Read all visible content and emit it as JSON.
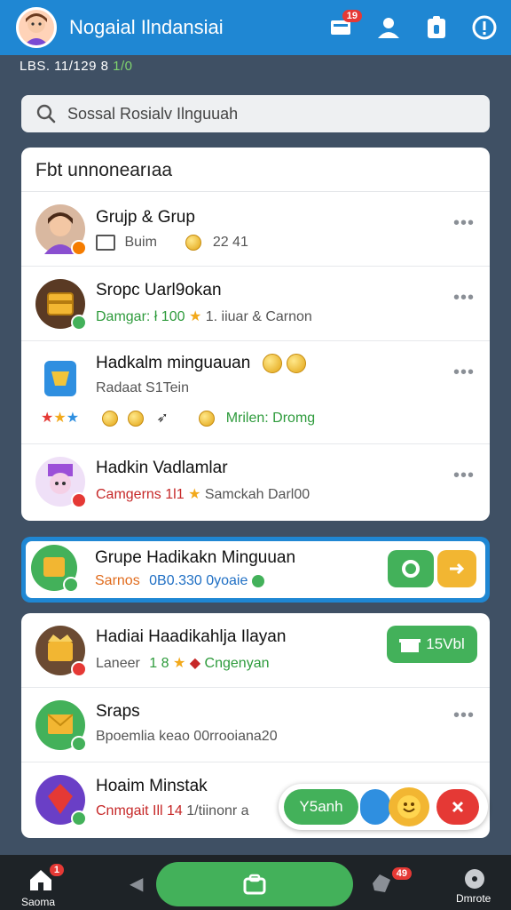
{
  "header": {
    "title": "Nogaial Ilndansiai",
    "chat_badge": "19",
    "icons": [
      "chat-icon",
      "person-icon",
      "clipboard-icon",
      "alert-icon"
    ]
  },
  "statusline": {
    "left": "LBS. 11/129 8 ",
    "right": "1/0"
  },
  "search": {
    "placeholder": "Sossal Rosialv Ilnguuah"
  },
  "section1": {
    "heading": "Fbt unnonearıaa",
    "items": [
      {
        "title": "Grujp & Grup",
        "sub_left": "Buim",
        "sub_right": "22 41"
      },
      {
        "title": "Sropc Uarl9okan",
        "sub_green": "Damgar: ł 100",
        "sub_rest": "1. iiuar & Carnon"
      },
      {
        "title": "Hadkalm minguauan",
        "sub": "Radaat S1Tein",
        "extra": "Mrilen: Dromg"
      },
      {
        "title": "Hadkin Vadlamlar",
        "sub_red": "Camgerns 1l1",
        "sub_rest": "Samckah Darl00"
      }
    ]
  },
  "highlight": {
    "title": "Grupe Hadikakn Minguuan",
    "sub_orange": "Sarnos",
    "sub_blue": "0B0.330 0yoaie"
  },
  "section2": {
    "items": [
      {
        "title": "Hadiai Haadikahlja Ilayan",
        "sub_left": "Laneer",
        "sub_green": "1 8",
        "sub_right": "Cngenyan",
        "pill": "15Vbl"
      },
      {
        "title": "Sraps",
        "sub": "Bpoemlia keao 00rrooiana20"
      },
      {
        "title": "Hoaim Minstak",
        "sub_red": "Cnmgait Ill 14",
        "sub_rest": "1/tiinonr a"
      }
    ]
  },
  "floatbar": {
    "green_label": "Y5anh"
  },
  "bottom_nav": {
    "home_label": "Saoma",
    "home_badge": "1",
    "inbox_badge": "49",
    "more_label": "Dmrote"
  },
  "colors": {
    "primary": "#1f87d3",
    "green": "#43b15a",
    "orange": "#f2a91b",
    "red": "#e53935"
  }
}
